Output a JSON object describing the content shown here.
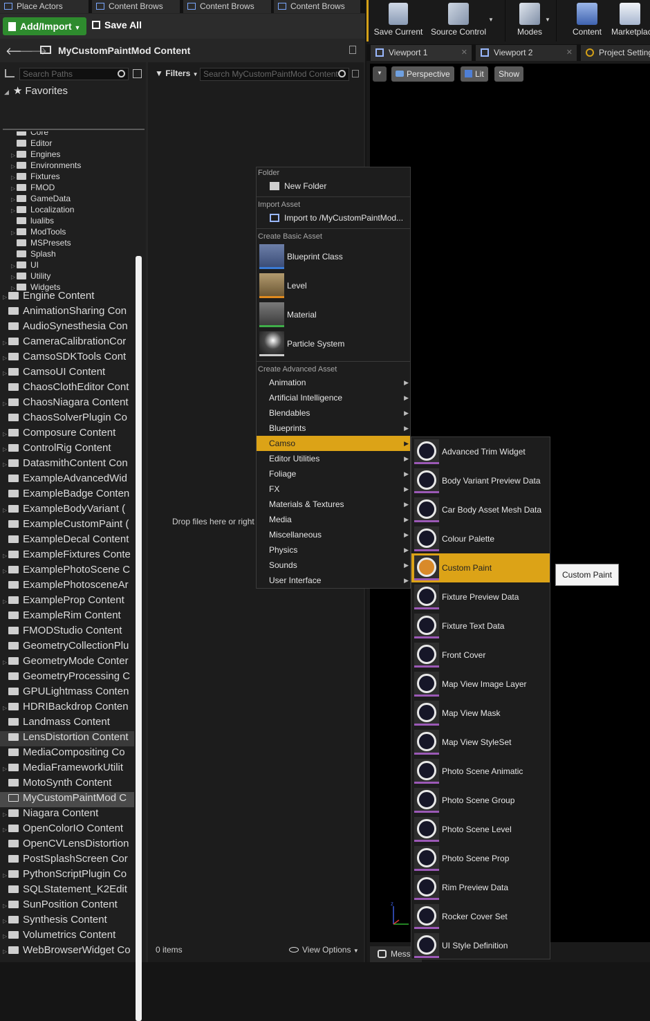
{
  "tabs": [
    "Place Actors",
    "Content Brows",
    "Content Brows",
    "Content Brows"
  ],
  "toolbar": {
    "add_import": "Add/Import",
    "save_all": "Save All"
  },
  "path": {
    "title": "MyCustomPaintMod Content"
  },
  "tree": {
    "search_placeholder": "Search Paths",
    "favorites": "Favorites",
    "sub_items": [
      "Core",
      "Editor",
      "Engines",
      "Environments",
      "Fixtures",
      "FMOD",
      "GameData",
      "Localization",
      "lualibs",
      "ModTools",
      "MSPresets",
      "Splash",
      "UI",
      "Utility",
      "Widgets"
    ],
    "items": [
      "Engine Content",
      "AnimationSharing Con",
      "AudioSynesthesia Con",
      "CameraCalibrationCor",
      "CamsoSDKTools Cont",
      "CamsoUI Content",
      "ChaosClothEditor Cont",
      "ChaosNiagara Content",
      "ChaosSolverPlugin Co",
      "Composure Content",
      "ControlRig Content",
      "DatasmithContent Con",
      "ExampleAdvancedWid",
      "ExampleBadge Conten",
      "ExampleBodyVariant (",
      "ExampleCustomPaint (",
      "ExampleDecal Content",
      "ExampleFixtures Conte",
      "ExamplePhotoScene C",
      "ExamplePhotosceneAr",
      "ExampleProp Content",
      "ExampleRim Content",
      "FMODStudio Content",
      "GeometryCollectionPlu",
      "GeometryMode Conter",
      "GeometryProcessing C",
      "GPULightmass Conten",
      "HDRIBackdrop Conten",
      "Landmass Content",
      "LensDistortion Content",
      "MediaCompositing Co",
      "MediaFrameworkUtilit",
      "MotoSynth Content",
      "MyCustomPaintMod C",
      "Niagara Content",
      "OpenColorIO Content",
      "OpenCVLensDistortion",
      "PostSplashScreen Cor",
      "PythonScriptPlugin Co",
      "SQLStatement_K2Edit",
      "SunPosition Content",
      "Synthesis Content",
      "Volumetrics Content",
      "WebBrowserWidget Co"
    ]
  },
  "content": {
    "filters": "Filters",
    "search_placeholder": "Search MyCustomPaintMod Content",
    "drop_message": "Drop files here or right",
    "item_count": "0 items",
    "view_options": "View Options"
  },
  "editor_toolbar": [
    "Save Current",
    "Source Control",
    "Modes",
    "Content",
    "Marketplace"
  ],
  "viewport_tabs": [
    "Viewport 1",
    "Viewport 2",
    "Project Settings"
  ],
  "viewport": {
    "perspective": "Perspective",
    "lit": "Lit",
    "show": "Show",
    "messages_tab": "Mess"
  },
  "context_menu": {
    "folder_header": "Folder",
    "new_folder": "New Folder",
    "import_header": "Import Asset",
    "import_to": "Import to /MyCustomPaintMod...",
    "basic_header": "Create Basic Asset",
    "basic": [
      "Blueprint Class",
      "Level",
      "Material",
      "Particle System"
    ],
    "advanced_header": "Create Advanced Asset",
    "advanced": [
      "Animation",
      "Artificial Intelligence",
      "Blendables",
      "Blueprints",
      "Camso",
      "Editor Utilities",
      "Foliage",
      "FX",
      "Materials & Textures",
      "Media",
      "Miscellaneous",
      "Physics",
      "Sounds",
      "User Interface"
    ]
  },
  "camso_submenu": [
    "Advanced Trim Widget",
    "Body Variant Preview Data",
    "Car Body Asset Mesh Data",
    "Colour Palette",
    "Custom Paint",
    "Fixture Preview Data",
    "Fixture Text Data",
    "Front Cover",
    "Map View Image Layer",
    "Map View Mask",
    "Map View StyleSet",
    "Photo Scene Animatic",
    "Photo Scene Group",
    "Photo Scene Level",
    "Photo Scene Prop",
    "Rim Preview Data",
    "Rocker Cover Set",
    "UI Style Definition"
  ],
  "tooltip": "Custom Paint",
  "colors": {
    "accent": "#dca317",
    "add_button": "#2e8b2e",
    "asset_underline": "#9b59b6"
  }
}
